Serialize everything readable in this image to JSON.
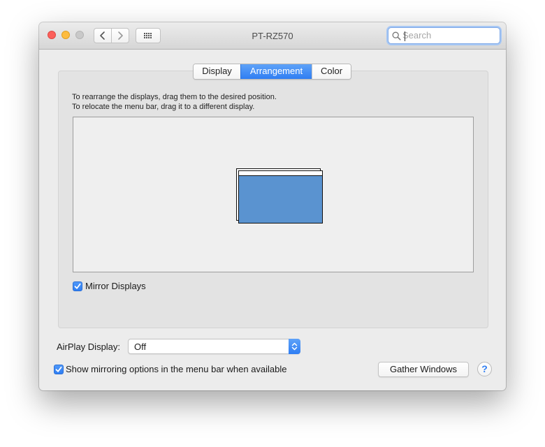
{
  "window": {
    "title": "PT-RZ570",
    "search": {
      "placeholder": "Search",
      "value": ""
    }
  },
  "tabs": [
    {
      "label": "Display",
      "active": false
    },
    {
      "label": "Arrangement",
      "active": true
    },
    {
      "label": "Color",
      "active": false
    }
  ],
  "arrangement": {
    "instruction_line1": "To rearrange the displays, drag them to the desired position.",
    "instruction_line2": "To relocate the menu bar, drag it to a different display.",
    "mirror_displays": {
      "label": "Mirror Displays",
      "checked": true
    }
  },
  "airplay": {
    "label": "AirPlay Display:",
    "selected": "Off"
  },
  "mirroring_options": {
    "label": "Show mirroring options in the menu bar when available",
    "checked": true
  },
  "buttons": {
    "gather_windows": "Gather Windows",
    "help": "?"
  },
  "colors": {
    "accent": "#2f7ef3",
    "display_fill": "#5a93d0",
    "close": "#fc605b",
    "minimize": "#fdbc40",
    "zoom_disabled": "#c9c9c9"
  },
  "icons": {
    "back": "chevron-left-icon",
    "forward": "chevron-right-icon",
    "show_all": "grid-icon",
    "search": "magnifier-icon"
  }
}
